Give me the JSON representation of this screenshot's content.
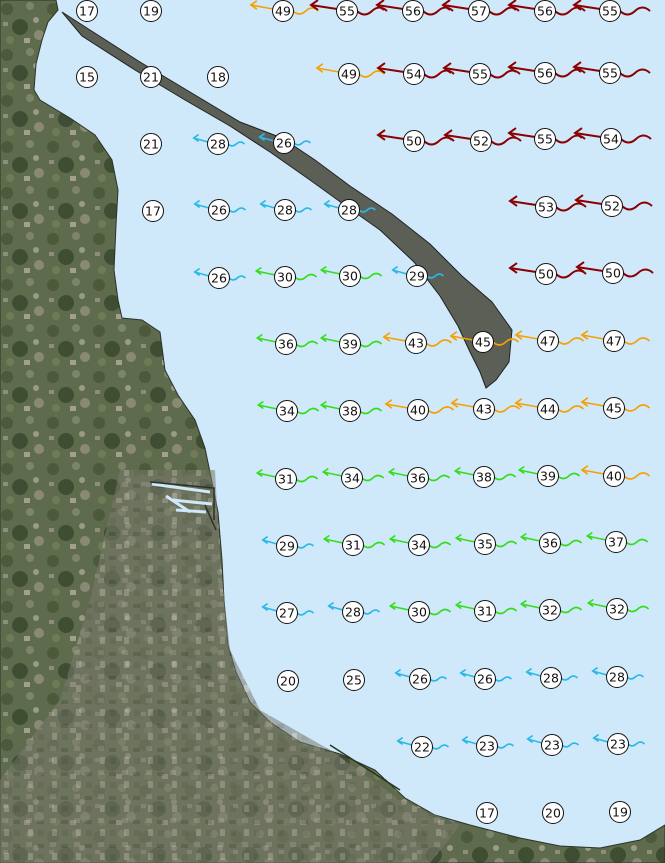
{
  "map": {
    "type": "satellite",
    "water_color": "#cfe9fb",
    "legend_colors": {
      "very_strong": "#8b0000",
      "strong": "#f5a000",
      "moderate": "#33dd1a",
      "light": "#2ab8e8"
    },
    "markers": [
      {
        "v": "17",
        "c": "none"
      },
      {
        "v": "19",
        "c": "none"
      },
      {
        "v": "49",
        "c": "strong"
      },
      {
        "v": "55",
        "c": "very_strong"
      },
      {
        "v": "56",
        "c": "very_strong"
      },
      {
        "v": "57",
        "c": "very_strong"
      },
      {
        "v": "56",
        "c": "very_strong"
      },
      {
        "v": "55",
        "c": "very_strong"
      },
      {
        "v": "15",
        "c": "none"
      },
      {
        "v": "21",
        "c": "none"
      },
      {
        "v": "18",
        "c": "none"
      },
      {
        "v": "49",
        "c": "strong"
      },
      {
        "v": "54",
        "c": "very_strong"
      },
      {
        "v": "55",
        "c": "very_strong"
      },
      {
        "v": "56",
        "c": "very_strong"
      },
      {
        "v": "55",
        "c": "very_strong"
      },
      {
        "v": "21",
        "c": "none"
      },
      {
        "v": "28",
        "c": "light"
      },
      {
        "v": "26",
        "c": "light"
      },
      {
        "v": "50",
        "c": "very_strong"
      },
      {
        "v": "52",
        "c": "very_strong"
      },
      {
        "v": "55",
        "c": "very_strong"
      },
      {
        "v": "54",
        "c": "very_strong"
      },
      {
        "v": "17",
        "c": "none"
      },
      {
        "v": "26",
        "c": "light"
      },
      {
        "v": "28",
        "c": "light"
      },
      {
        "v": "28",
        "c": "light"
      },
      {
        "v": "53",
        "c": "very_strong"
      },
      {
        "v": "52",
        "c": "very_strong"
      },
      {
        "v": "26",
        "c": "light"
      },
      {
        "v": "30",
        "c": "moderate"
      },
      {
        "v": "30",
        "c": "moderate"
      },
      {
        "v": "29",
        "c": "light"
      },
      {
        "v": "50",
        "c": "very_strong"
      },
      {
        "v": "50",
        "c": "very_strong"
      },
      {
        "v": "36",
        "c": "moderate"
      },
      {
        "v": "39",
        "c": "moderate"
      },
      {
        "v": "43",
        "c": "strong"
      },
      {
        "v": "45",
        "c": "strong"
      },
      {
        "v": "47",
        "c": "strong"
      },
      {
        "v": "47",
        "c": "strong"
      },
      {
        "v": "34",
        "c": "moderate"
      },
      {
        "v": "38",
        "c": "moderate"
      },
      {
        "v": "40",
        "c": "strong"
      },
      {
        "v": "43",
        "c": "strong"
      },
      {
        "v": "44",
        "c": "strong"
      },
      {
        "v": "45",
        "c": "strong"
      },
      {
        "v": "31",
        "c": "moderate"
      },
      {
        "v": "34",
        "c": "moderate"
      },
      {
        "v": "36",
        "c": "moderate"
      },
      {
        "v": "38",
        "c": "moderate"
      },
      {
        "v": "39",
        "c": "moderate"
      },
      {
        "v": "40",
        "c": "strong"
      },
      {
        "v": "29",
        "c": "light"
      },
      {
        "v": "31",
        "c": "moderate"
      },
      {
        "v": "34",
        "c": "moderate"
      },
      {
        "v": "35",
        "c": "moderate"
      },
      {
        "v": "36",
        "c": "moderate"
      },
      {
        "v": "37",
        "c": "moderate"
      },
      {
        "v": "27",
        "c": "light"
      },
      {
        "v": "28",
        "c": "light"
      },
      {
        "v": "30",
        "c": "moderate"
      },
      {
        "v": "31",
        "c": "moderate"
      },
      {
        "v": "32",
        "c": "moderate"
      },
      {
        "v": "32",
        "c": "moderate"
      },
      {
        "v": "20",
        "c": "none"
      },
      {
        "v": "25",
        "c": "none"
      },
      {
        "v": "26",
        "c": "light"
      },
      {
        "v": "26",
        "c": "light"
      },
      {
        "v": "28",
        "c": "light"
      },
      {
        "v": "28",
        "c": "light"
      },
      {
        "v": "22",
        "c": "light"
      },
      {
        "v": "23",
        "c": "light"
      },
      {
        "v": "23",
        "c": "light"
      },
      {
        "v": "23",
        "c": "light"
      },
      {
        "v": "17",
        "c": "none"
      },
      {
        "v": "20",
        "c": "none"
      },
      {
        "v": "19",
        "c": "none"
      }
    ]
  }
}
